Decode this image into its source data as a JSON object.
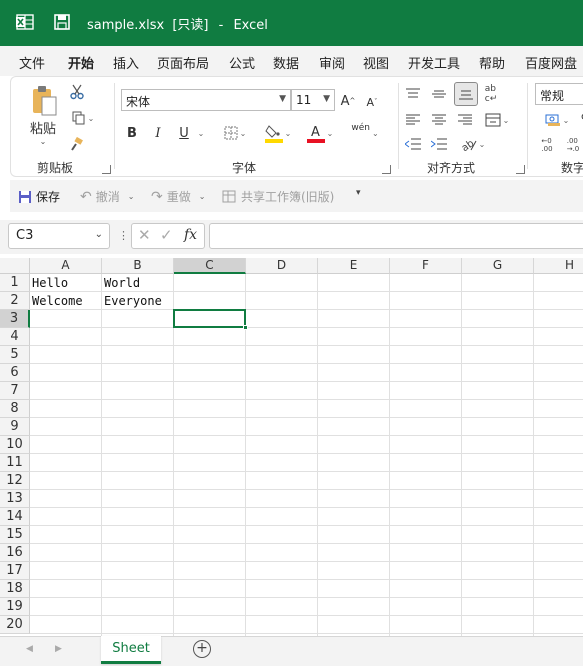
{
  "window": {
    "file_name": "sample.xlsx",
    "readonly_tag": "[只读]",
    "separator": "-",
    "app_name": "Excel"
  },
  "tabs": [
    "文件",
    "开始",
    "插入",
    "页面布局",
    "公式",
    "数据",
    "审阅",
    "视图",
    "开发工具",
    "帮助",
    "百度网盘"
  ],
  "active_tab": "开始",
  "ribbon": {
    "clipboard": {
      "paste": "粘贴",
      "label": "剪贴板"
    },
    "font": {
      "name": "宋体",
      "size": "11",
      "bold": "B",
      "italic": "I",
      "underline": "U",
      "label": "字体",
      "phonetic": "wén"
    },
    "alignment": {
      "label": "对齐方式"
    },
    "number": {
      "format": "常规",
      "label": "数字"
    }
  },
  "qat": {
    "save": "保存",
    "undo": "撤消",
    "redo": "重做",
    "share": "共享工作簿(旧版)"
  },
  "formula_bar": {
    "name_box": "C3",
    "fx": "fx",
    "formula": ""
  },
  "grid": {
    "columns": [
      "A",
      "B",
      "C",
      "D",
      "E",
      "F",
      "G",
      "H"
    ],
    "rows": [
      "1",
      "2",
      "3",
      "4",
      "5",
      "6",
      "7",
      "8",
      "9",
      "10",
      "11",
      "12",
      "13",
      "14",
      "15",
      "16",
      "17",
      "18",
      "19",
      "20"
    ],
    "cells": {
      "A1": "Hello",
      "B1": "World",
      "A2": "Welcome",
      "B2": "Everyone"
    },
    "selected": "C3"
  },
  "sheets": [
    "Sheet"
  ],
  "colors": {
    "brand": "#107c41",
    "header_bg": "#f3f3f3",
    "gridline": "#e0e0e0",
    "selected_header": "#d2d2d2"
  }
}
